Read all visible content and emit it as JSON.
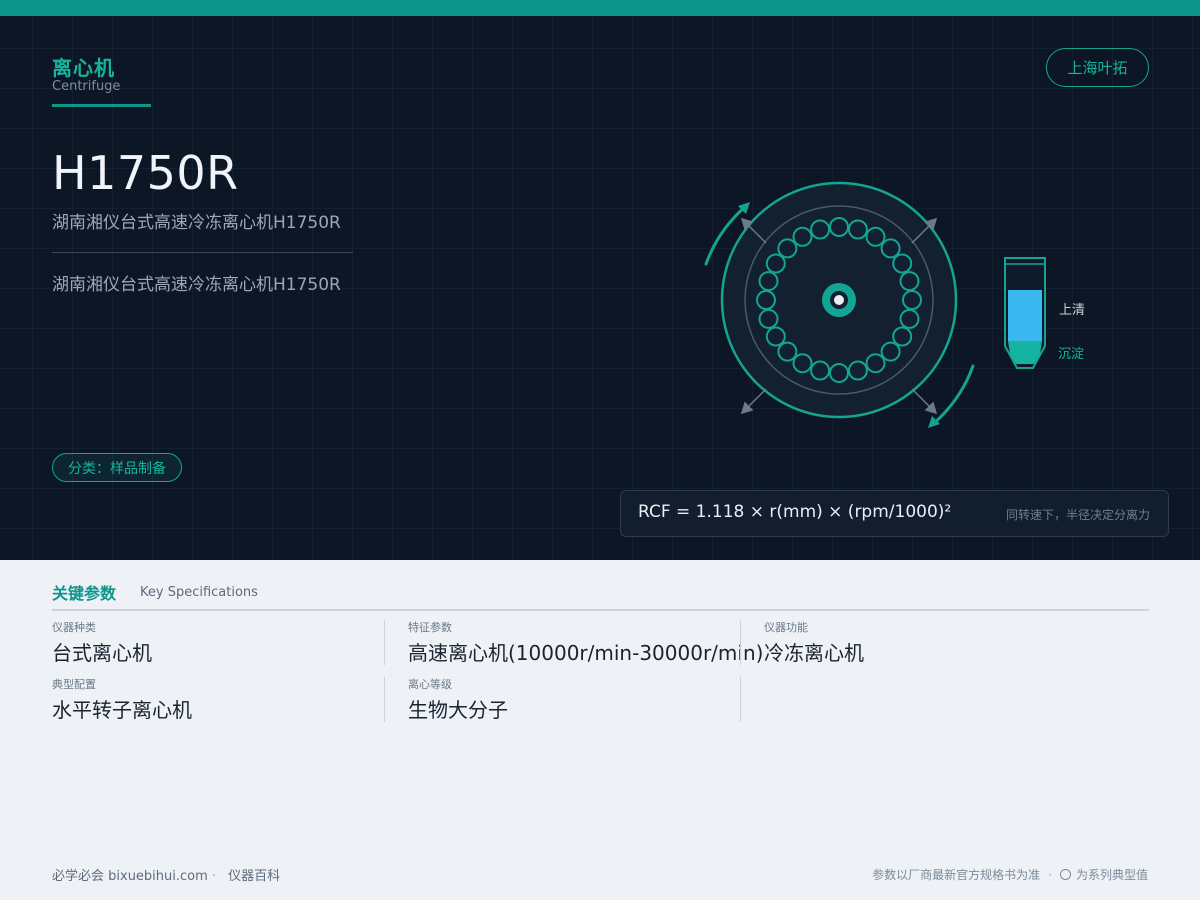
{
  "header": {
    "category_cn": "离心机",
    "category_en": "Centrifuge",
    "brand": "上海叶拓"
  },
  "hero": {
    "model": "H1750R",
    "subtitle": "湖南湘仪台式高速冷冻离心机H1750R",
    "description": "湖南湘仪台式高速冷冻离心机H1750R",
    "tag": "分类：样品制备"
  },
  "illustration": {
    "supernatant_label": "上清",
    "sediment_label": "沉淀",
    "accent_color": "#14a494",
    "liquid_color": "#3ab8f0",
    "sediment_color": "#14b4a0"
  },
  "formula": {
    "text": "RCF = 1.118 × r(mm) × (rpm/1000)²",
    "note": "同转速下，半径决定分离力"
  },
  "specs": {
    "title": "关键参数",
    "subtitle": "Key Specifications",
    "items": [
      {
        "label": "仪器种类",
        "value": "台式离心机"
      },
      {
        "label": "特征参数",
        "value": "高速离心机(10000r/min-30000r/min)"
      },
      {
        "label": "仪器功能",
        "value": "冷冻离心机"
      },
      {
        "label": "典型配置",
        "value": "水平转子离心机"
      },
      {
        "label": "离心等级",
        "value": "生物大分子"
      }
    ]
  },
  "footer": {
    "site": "必学必会 bixuebihui.com",
    "section": "仪器百科",
    "disclaimer": "参数以厂商最新官方规格书为准",
    "legend": "为系列典型值"
  }
}
